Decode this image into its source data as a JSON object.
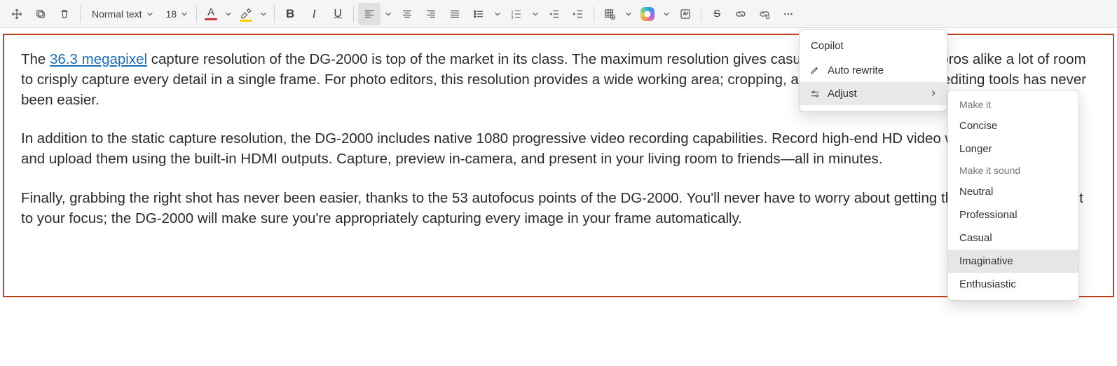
{
  "toolbar": {
    "style_name": "Normal text",
    "font_size": "18"
  },
  "document": {
    "underlined": "36.3 megapixel",
    "p1a": "The ",
    "p1b": " capture resolution of the DG-2000 is top of the market in its class. The maximum resolution gives casual photographers and pros alike a lot of room to crisply capture every detail in a single frame. For photo editors, this resolution provides a wide working area; cropping, and painting with photo editing tools has never been easier.",
    "p2": "In addition to the static capture resolution, the DG-2000 includes native 1080 progressive video recording capabilities. Record high-end HD video with ease, and view and upload them using the built-in HDMI outputs. Capture, preview in-camera, and present in your living room to friends—all in minutes.",
    "p3": "Finally, grabbing the right shot has never been easier, thanks to the 53 autofocus points of the DG-2000. You'll never have to worry about getting the perfect adjustment to your focus; the DG-2000 will make sure you're appropriately capturing every image in your frame automatically."
  },
  "copilot_menu": {
    "title": "Copilot",
    "auto_rewrite": "Auto rewrite",
    "adjust": "Adjust"
  },
  "adjust_submenu": {
    "head1": "Make it",
    "concise": "Concise",
    "longer": "Longer",
    "head2": "Make it sound",
    "neutral": "Neutral",
    "professional": "Professional",
    "casual": "Casual",
    "imaginative": "Imaginative",
    "enthusiastic": "Enthusiastic"
  }
}
